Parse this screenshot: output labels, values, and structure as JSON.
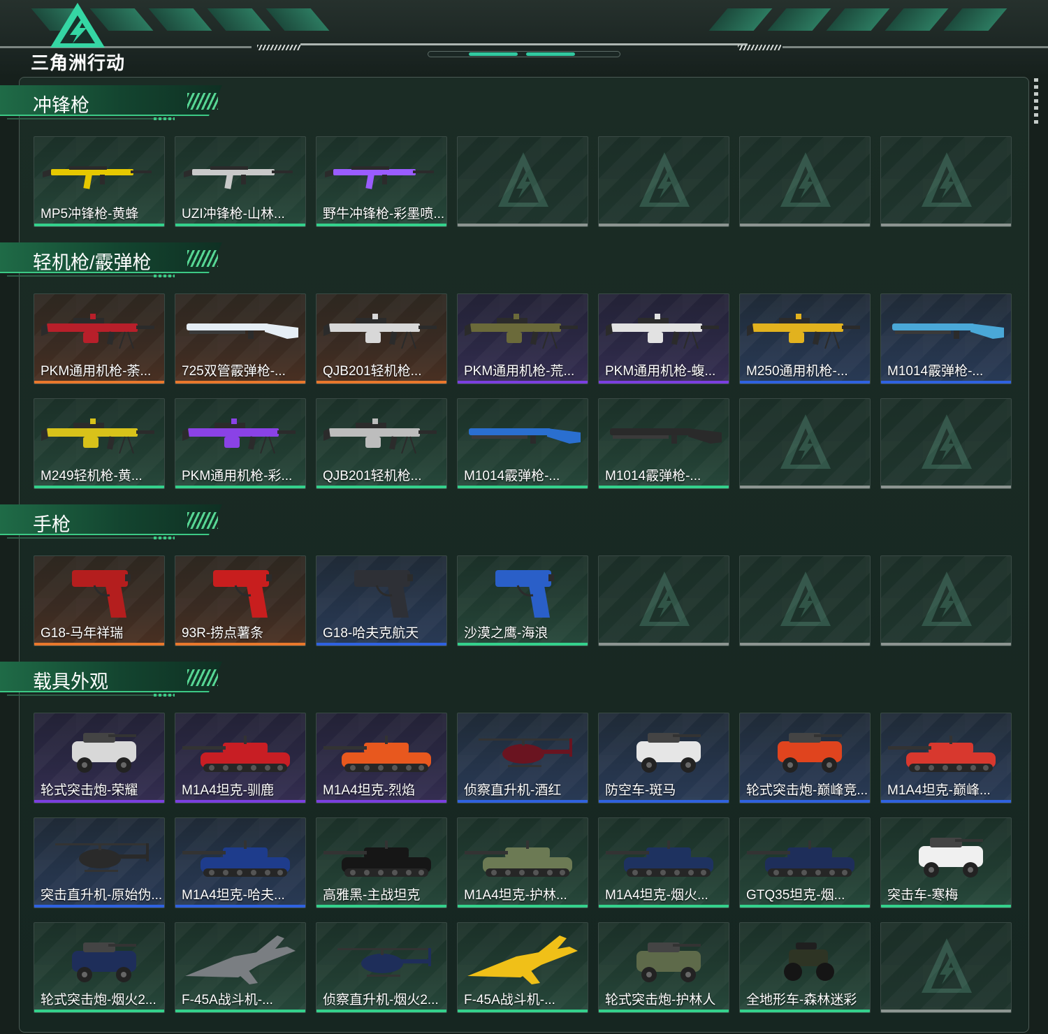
{
  "app": {
    "logo_text": "三角洲行动"
  },
  "sections": [
    {
      "title": "冲锋枪"
    },
    {
      "title": "轻机枪/霰弹枪"
    },
    {
      "title": "手枪"
    },
    {
      "title": "载具外观"
    }
  ],
  "rows": [
    {
      "section": 0,
      "items": [
        {
          "label": "MP5冲锋枪-黄蜂",
          "rarity": "green",
          "icon": "smg-icon",
          "color": "#e6c800"
        },
        {
          "label": "UZI冲锋枪-山林...",
          "rarity": "green",
          "icon": "smg-icon",
          "color": "#c9c9c9"
        },
        {
          "label": "野牛冲锋枪-彩墨喷...",
          "rarity": "green",
          "icon": "smg-icon",
          "color": "#9a5cff"
        },
        {
          "label": "",
          "rarity": "empty"
        },
        {
          "label": "",
          "rarity": "empty"
        },
        {
          "label": "",
          "rarity": "empty"
        },
        {
          "label": "",
          "rarity": "empty"
        }
      ]
    },
    {
      "section": 1,
      "items": [
        {
          "label": "PKM通用机枪-荼...",
          "rarity": "gold",
          "icon": "machine-gun-icon",
          "color": "#b81f2a"
        },
        {
          "label": "725双管霰弹枪-...",
          "rarity": "gold",
          "icon": "shotgun-icon",
          "color": "#e6eef5"
        },
        {
          "label": "QJB201轻机枪...",
          "rarity": "gold",
          "icon": "machine-gun-icon",
          "color": "#d8d8d8"
        },
        {
          "label": "PKM通用机枪-荒...",
          "rarity": "purple",
          "icon": "machine-gun-icon",
          "color": "#6b6a3a"
        },
        {
          "label": "PKM通用机枪-蝮...",
          "rarity": "purple",
          "icon": "machine-gun-icon",
          "color": "#e2e2e2"
        },
        {
          "label": "M250通用机枪-...",
          "rarity": "blue",
          "icon": "machine-gun-icon",
          "color": "#e2b21e"
        },
        {
          "label": "M1014霰弹枪-...",
          "rarity": "blue",
          "icon": "shotgun-icon",
          "color": "#4aa8d8"
        }
      ]
    },
    {
      "section": 1,
      "items": [
        {
          "label": "M249轻机枪-黄...",
          "rarity": "green",
          "icon": "machine-gun-icon",
          "color": "#d8c21a"
        },
        {
          "label": "PKM通用机枪-彩...",
          "rarity": "green",
          "icon": "machine-gun-icon",
          "color": "#8a42e6"
        },
        {
          "label": "QJB201轻机枪...",
          "rarity": "green",
          "icon": "machine-gun-icon",
          "color": "#bdbdbd"
        },
        {
          "label": "M1014霰弹枪-...",
          "rarity": "green",
          "icon": "shotgun-icon",
          "color": "#2a6fd0"
        },
        {
          "label": "M1014霰弹枪-...",
          "rarity": "green",
          "icon": "shotgun-icon",
          "color": "#2a2a2a"
        },
        {
          "label": "",
          "rarity": "empty"
        },
        {
          "label": "",
          "rarity": "empty"
        }
      ]
    },
    {
      "section": 2,
      "items": [
        {
          "label": "G18-马年祥瑞",
          "rarity": "gold",
          "icon": "pistol-icon",
          "color": "#b41e1e"
        },
        {
          "label": "93R-捞点薯条",
          "rarity": "gold",
          "icon": "pistol-icon",
          "color": "#c81e1e"
        },
        {
          "label": "G18-哈夫克航天",
          "rarity": "blue",
          "icon": "pistol-icon",
          "color": "#2e3036"
        },
        {
          "label": "沙漠之鹰-海浪",
          "rarity": "green",
          "icon": "pistol-icon",
          "color": "#2a5fc8"
        },
        {
          "label": "",
          "rarity": "empty"
        },
        {
          "label": "",
          "rarity": "empty"
        },
        {
          "label": "",
          "rarity": "empty"
        }
      ]
    },
    {
      "section": 3,
      "items": [
        {
          "label": "轮式突击炮-荣耀",
          "rarity": "purple",
          "icon": "armored-car-icon",
          "color": "#d8d8d8"
        },
        {
          "label": "M1A4坦克-驯鹿",
          "rarity": "purple",
          "icon": "tank-icon",
          "color": "#c81e24"
        },
        {
          "label": "M1A4坦克-烈焰",
          "rarity": "purple",
          "icon": "tank-icon",
          "color": "#e8581e"
        },
        {
          "label": "侦察直升机-酒红",
          "rarity": "blue",
          "icon": "helicopter-icon",
          "color": "#6a1420"
        },
        {
          "label": "防空车-斑马",
          "rarity": "blue",
          "icon": "armored-car-icon",
          "color": "#e6e6e6"
        },
        {
          "label": "轮式突击炮-巅峰竞...",
          "rarity": "blue",
          "icon": "armored-car-icon",
          "color": "#e0441e"
        },
        {
          "label": "M1A4坦克-巅峰...",
          "rarity": "blue",
          "icon": "tank-icon",
          "color": "#d8382e"
        }
      ]
    },
    {
      "section": 3,
      "items": [
        {
          "label": "突击直升机-原始伪...",
          "rarity": "blue",
          "icon": "helicopter-icon",
          "color": "#2a2a2a"
        },
        {
          "label": "M1A4坦克-哈夫...",
          "rarity": "blue",
          "icon": "tank-icon",
          "color": "#1e3c8c"
        },
        {
          "label": "高雅黑-主战坦克",
          "rarity": "green",
          "icon": "tank-icon",
          "color": "#161616"
        },
        {
          "label": "M1A4坦克-护林...",
          "rarity": "green",
          "icon": "tank-icon",
          "color": "#6c7a54"
        },
        {
          "label": "M1A4坦克-烟火...",
          "rarity": "green",
          "icon": "tank-icon",
          "color": "#1e3260"
        },
        {
          "label": "GTQ35坦克-烟...",
          "rarity": "green",
          "icon": "tank-icon",
          "color": "#1e2e5a"
        },
        {
          "label": "突击车-寒梅",
          "rarity": "green",
          "icon": "armored-car-icon",
          "color": "#f0f0f0"
        }
      ]
    },
    {
      "section": 3,
      "items": [
        {
          "label": "轮式突击炮-烟火2...",
          "rarity": "green",
          "icon": "armored-car-icon",
          "color": "#1e2e5a"
        },
        {
          "label": "F-45A战斗机-...",
          "rarity": "green",
          "icon": "jet-icon",
          "color": "#7a7e82"
        },
        {
          "label": "侦察直升机-烟火2...",
          "rarity": "green",
          "icon": "helicopter-icon",
          "color": "#1e2e5a"
        },
        {
          "label": "F-45A战斗机-...",
          "rarity": "green",
          "icon": "jet-icon",
          "color": "#f0c018"
        },
        {
          "label": "轮式突击炮-护林人",
          "rarity": "green",
          "icon": "armored-car-icon",
          "color": "#5e6a4a"
        },
        {
          "label": "全地形车-森林迷彩",
          "rarity": "green",
          "icon": "atv-icon",
          "color": "#2e3424"
        },
        {
          "label": "",
          "rarity": "empty"
        }
      ]
    }
  ],
  "colors": {
    "accent": "#3cc985",
    "gold": "#e8782c",
    "purple": "#7b3fe0",
    "blue": "#2f62e0",
    "green": "#34d18c"
  }
}
